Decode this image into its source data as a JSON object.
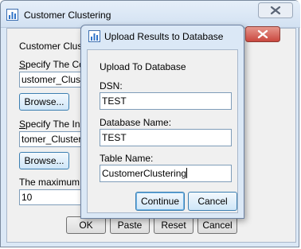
{
  "parent_window": {
    "title": "Customer Clustering",
    "labels": {
      "model_name": "Customer Clus",
      "specify_co": "Specify The Co",
      "specify_in": "Specify The Inp",
      "maximum": "The maximum"
    },
    "fields": {
      "model_path": "ustomer_Clust",
      "input_path": "tomer_Cluster",
      "maximum_value": "10"
    },
    "buttons": {
      "browse_1": "Browse...",
      "browse_2": "Browse...",
      "ok": "OK",
      "paste": "Paste",
      "reset": "Reset",
      "cancel": "Cancel"
    }
  },
  "dialog": {
    "title": "Upload Results to Database",
    "section_label": "Upload To Database",
    "dsn_label": "DSN:",
    "dsn_value": "TEST",
    "database_name_label": "Database Name:",
    "database_name_value": "TEST",
    "table_name_label": "Table Name:",
    "table_name_value": "CustomerClustering",
    "continue_label": "Continue",
    "cancel_label": "Cancel"
  },
  "icons": [
    "app-icon",
    "close-icon"
  ],
  "colors": {
    "close_button": "#c9463d",
    "titlebar": "#dbe8f6",
    "client": "#f0f0f0"
  }
}
